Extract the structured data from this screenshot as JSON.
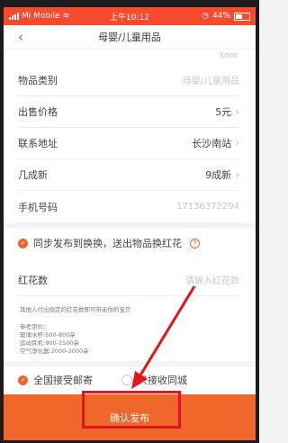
{
  "statusbar": {
    "carrier": "Mi Mobile",
    "time": "上午10:12",
    "battery": "44%"
  },
  "header": {
    "back_icon": "chevron-left-icon",
    "title": "母婴/儿童用品"
  },
  "counter": "3/500",
  "form": {
    "category": {
      "label": "物品类别",
      "placeholder": "母婴/儿童用品"
    },
    "price": {
      "label": "出售价格",
      "value": "5元"
    },
    "address": {
      "label": "联系地址",
      "value": "长沙南站"
    },
    "condition": {
      "label": "几成新",
      "value": "9成新"
    },
    "phone": {
      "label": "手机号码",
      "value": "17136372294"
    }
  },
  "sync": {
    "label": "同步发布到换换，送出物品换红花",
    "checked": true
  },
  "flowers": {
    "label": "红花数",
    "placeholder": "请输入红花数"
  },
  "notes": {
    "line1": "其他人付出指定的红花数即可带走你的宝贝",
    "line2": "参考定价：",
    "line3": "玻璃水杯:500-800朵",
    "line4": "运动耳机:900-1500朵",
    "line5": "空气净化器:2000-3000朵"
  },
  "shipping": {
    "nationwide_label": "全国接受邮寄",
    "nationwide_checked": true,
    "local_label": "只接收同城",
    "local_checked": false
  },
  "confirm_label": "确认发布",
  "colors": {
    "accent": "#f0672b",
    "statusbar": "#fb4b2e",
    "annotation": "#e0161c"
  }
}
